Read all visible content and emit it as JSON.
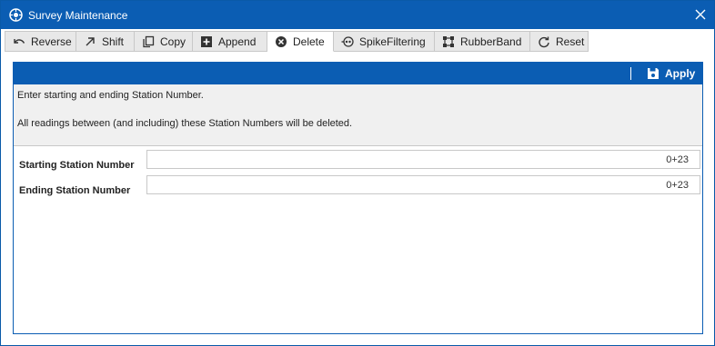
{
  "window": {
    "title": "Survey Maintenance"
  },
  "tabs": [
    {
      "label": "Reverse",
      "icon": "undo-icon"
    },
    {
      "label": "Shift",
      "icon": "arrow-up-right-icon"
    },
    {
      "label": "Copy",
      "icon": "copy-icon"
    },
    {
      "label": "Append",
      "icon": "plus-box-icon"
    },
    {
      "label": "Delete",
      "icon": "close-circle-icon",
      "active": true
    },
    {
      "label": "SpikeFiltering",
      "icon": "spike-filter-icon"
    },
    {
      "label": "RubberBand",
      "icon": "rubberband-icon"
    },
    {
      "label": "Reset",
      "icon": "refresh-icon"
    }
  ],
  "toolbar": {
    "apply_label": "Apply"
  },
  "info": {
    "line1": "Enter starting and ending Station Number.",
    "line2": "All readings between (and including) these Station Numbers will be deleted."
  },
  "fields": {
    "starting_label": "Starting Station Number",
    "starting_value": "0+23",
    "ending_label": "Ending Station Number",
    "ending_value": "0+23"
  },
  "colors": {
    "accent": "#0b5db3",
    "tab_bg": "#e8e8e8",
    "info_bg": "#f0f0f0"
  }
}
